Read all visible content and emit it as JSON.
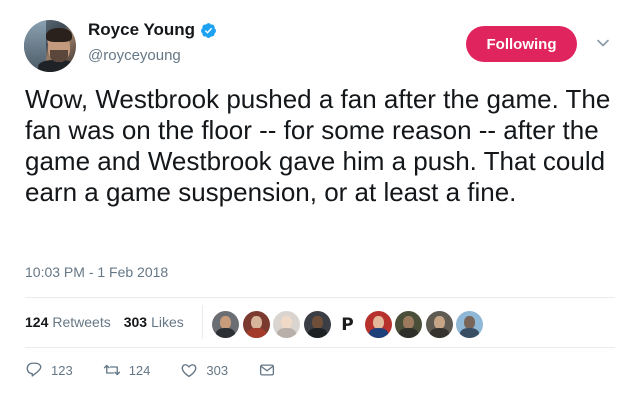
{
  "user": {
    "display_name": "Royce Young",
    "handle": "@royceyoung",
    "verified": true,
    "verified_color": "#1da1f2"
  },
  "follow_button": {
    "label": "Following",
    "color": "#e0245e"
  },
  "tweet": {
    "text": "Wow, Westbrook pushed a fan after the game. The fan was on the floor -- for some reason -- after the game and Westbrook gave him a push. That could earn a game suspension, or at least a fine.",
    "timestamp": "10:03 PM - 1 Feb 2018"
  },
  "stats": {
    "retweets_count": "124",
    "retweets_label": "Retweets",
    "likes_count": "303",
    "likes_label": "Likes"
  },
  "likers": [
    {
      "icon": "user-avatar",
      "bg": "#6b6e73"
    },
    {
      "icon": "user-avatar",
      "bg": "#7b3a2f"
    },
    {
      "icon": "user-avatar",
      "bg": "#d9d4cf"
    },
    {
      "icon": "user-avatar",
      "bg": "#3b3f45"
    },
    {
      "icon": "p-logo",
      "text": "P"
    },
    {
      "icon": "user-avatar",
      "bg": "#b7322c"
    },
    {
      "icon": "user-avatar",
      "bg": "#4a4f3a"
    },
    {
      "icon": "user-avatar",
      "bg": "#5f5a52"
    },
    {
      "icon": "user-avatar",
      "bg": "#8fb7d6"
    }
  ],
  "actions": {
    "reply_count": "123",
    "retweet_count": "124",
    "like_count": "303"
  },
  "colors": {
    "text_primary": "#14171a",
    "text_secondary": "#657786",
    "divider": "#e6ecf0"
  }
}
